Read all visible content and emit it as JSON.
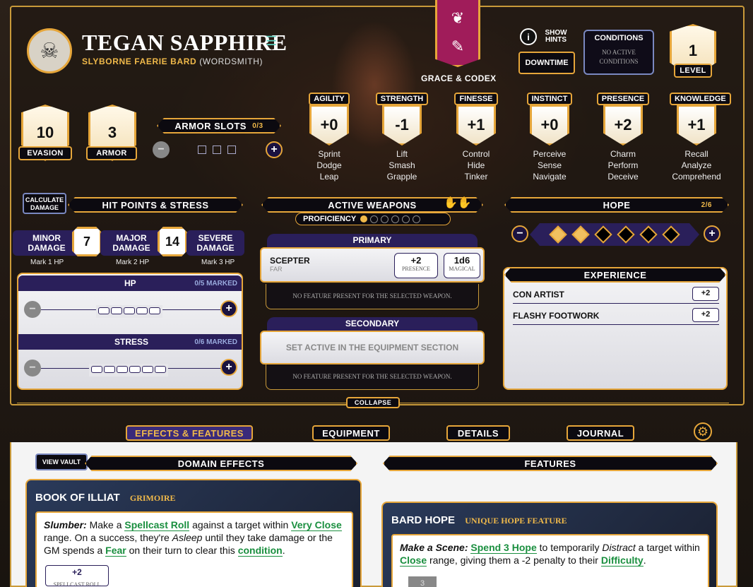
{
  "character": {
    "name": "TEGAN SAPPHIRE",
    "ancestry": "SLYBORNE FAERIE BARD",
    "subclass": "(WORDSMITH)",
    "domains": "GRACE & CODEX"
  },
  "header": {
    "show_hints": "SHOW HINTS",
    "downtime": "DOWNTIME",
    "conditions_title": "CONDITIONS",
    "conditions_value": "NO ACTIVE CONDITIONS",
    "level_value": "1",
    "level_label": "LEVEL"
  },
  "defense": {
    "evasion_value": "10",
    "evasion_label": "EVASION",
    "armor_value": "3",
    "armor_label": "ARMOR",
    "armor_slots_label": "ARMOR SLOTS",
    "armor_slots_count": "0/3"
  },
  "traits": [
    {
      "name": "AGILITY",
      "value": "+0",
      "a1": "Sprint",
      "a2": "Dodge",
      "a3": "Leap"
    },
    {
      "name": "STRENGTH",
      "value": "-1",
      "a1": "Lift",
      "a2": "Smash",
      "a3": "Grapple"
    },
    {
      "name": "FINESSE",
      "value": "+1",
      "a1": "Control",
      "a2": "Hide",
      "a3": "Tinker"
    },
    {
      "name": "INSTINCT",
      "value": "+0",
      "a1": "Perceive",
      "a2": "Sense",
      "a3": "Navigate"
    },
    {
      "name": "PRESENCE",
      "value": "+2",
      "a1": "Charm",
      "a2": "Perform",
      "a3": "Deceive"
    },
    {
      "name": "KNOWLEDGE",
      "value": "+1",
      "a1": "Recall",
      "a2": "Analyze",
      "a3": "Comprehend"
    }
  ],
  "hp_stress": {
    "calc_button": "CALCULATE DAMAGE",
    "title": "HIT POINTS & STRESS",
    "minor": "MINOR DAMAGE",
    "minor_note": "Mark 1 HP",
    "threshold1": "7",
    "major": "MAJOR DAMAGE",
    "major_note": "Mark 2 HP",
    "threshold2": "14",
    "severe": "SEVERE DAMAGE",
    "severe_note": "Mark 3 HP",
    "hp_label": "HP",
    "hp_marked": "0/5 MARKED",
    "stress_label": "STRESS",
    "stress_marked": "0/6 MARKED"
  },
  "weapons": {
    "title": "ACTIVE WEAPONS",
    "proficiency": "PROFICIENCY",
    "primary_label": "PRIMARY",
    "primary_name": "SCEPTER",
    "primary_range": "FAR",
    "primary_bonus": "+2",
    "primary_trait": "PRESENCE",
    "primary_damage": "1d6",
    "primary_type": "MAGICAL",
    "no_feature": "NO FEATURE PRESENT FOR THE SELECTED WEAPON.",
    "secondary_label": "SECONDARY",
    "secondary_placeholder": "SET ACTIVE IN THE EQUIPMENT SECTION",
    "no_feature2": "NO FEATURE PRESENT FOR THE SELECTED WEAPON."
  },
  "hope": {
    "title": "HOPE",
    "count": "2/6",
    "filled": 2,
    "total": 6
  },
  "experience": {
    "title": "EXPERIENCE",
    "items": [
      {
        "name": "CON ARTIST",
        "bonus": "+2"
      },
      {
        "name": "FLASHY FOOTWORK",
        "bonus": "+2"
      }
    ]
  },
  "collapse": "COLLAPSE",
  "tabs": {
    "effects": "EFFECTS & FEATURES",
    "equipment": "EQUIPMENT",
    "details": "DETAILS",
    "journal": "JOURNAL"
  },
  "domain_effects": {
    "view_vault": "VIEW VAULT",
    "title": "DOMAIN EFFECTS",
    "card_title": "BOOK OF ILLIAT",
    "card_type": "GRIMOIRE",
    "ability_name": "Slumber:",
    "t1": " Make a ",
    "k1": "Spellcast Roll",
    "t2": " against a target within ",
    "k2": "Very Close",
    "t3": " range. On a success, they're ",
    "em1": "Asleep",
    "t4": " until they take damage or the GM spends a ",
    "k3": "Fear",
    "t5": " on their turn to clear this ",
    "k4": "condition",
    "t6": ".",
    "roll_bonus": "+2",
    "roll_label": "SPELLCAST ROLL"
  },
  "features": {
    "title": "FEATURES",
    "card_title": "BARD HOPE",
    "card_type": "UNIQUE HOPE FEATURE",
    "ability_name": "Make a Scene:",
    "sp": " ",
    "k1": "Spend 3 Hope",
    "t1": " to temporarily ",
    "em1": "Distract",
    "t2": " a target within ",
    "k2": "Close",
    "t3": " range, giving them a -2 penalty to their ",
    "k3": "Difficulty",
    "t4": ".",
    "cost": "3"
  },
  "colors": {
    "accent": "#e6a63a",
    "purple": "#2a1f5a",
    "keyword": "#1a8f3f"
  }
}
